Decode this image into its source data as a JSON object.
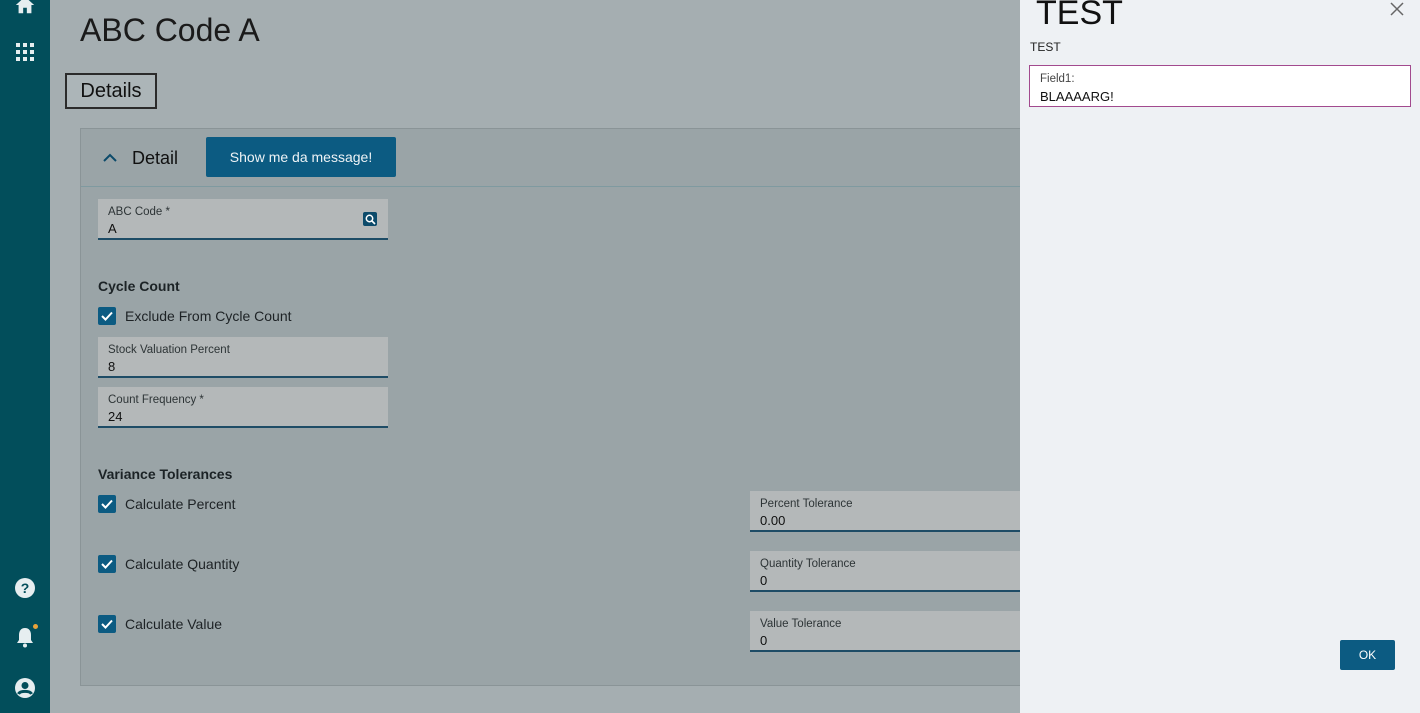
{
  "rail": {
    "icons": [
      "home-icon",
      "apps-grid-icon",
      "help-icon",
      "bell-icon",
      "user-icon"
    ],
    "notification_color": "#e8a33a"
  },
  "page": {
    "title": "ABC Code A",
    "tab_label": "Details"
  },
  "detail": {
    "section_title": "Detail",
    "message_button": "Show me da message!",
    "abc_code": {
      "label": "ABC Code *",
      "value": "A"
    }
  },
  "cycle_count": {
    "title": "Cycle Count",
    "exclude_label": "Exclude From Cycle Count",
    "exclude_checked": true,
    "stock_valuation": {
      "label": "Stock Valuation Percent",
      "value": "8"
    },
    "count_frequency": {
      "label": "Count Frequency *",
      "value": "24"
    }
  },
  "variance": {
    "title": "Variance Tolerances",
    "calc_percent": {
      "label": "Calculate Percent",
      "checked": true
    },
    "calc_quantity": {
      "label": "Calculate Quantity",
      "checked": true
    },
    "calc_value": {
      "label": "Calculate Value",
      "checked": true
    },
    "percent_tol": {
      "label": "Percent Tolerance",
      "value": "0.00"
    },
    "quantity_tol": {
      "label": "Quantity Tolerance",
      "value": "0"
    },
    "value_tol": {
      "label": "Value Tolerance",
      "value": "0"
    }
  },
  "dialog": {
    "title": "TEST",
    "subtitle": "TEST",
    "field": {
      "label": "Field1:",
      "value": "BLAAAARG!"
    },
    "ok_label": "OK"
  },
  "colors": {
    "rail": "#024e5b",
    "accent": "#0c5b82",
    "focus_border": "#a24a8e"
  }
}
